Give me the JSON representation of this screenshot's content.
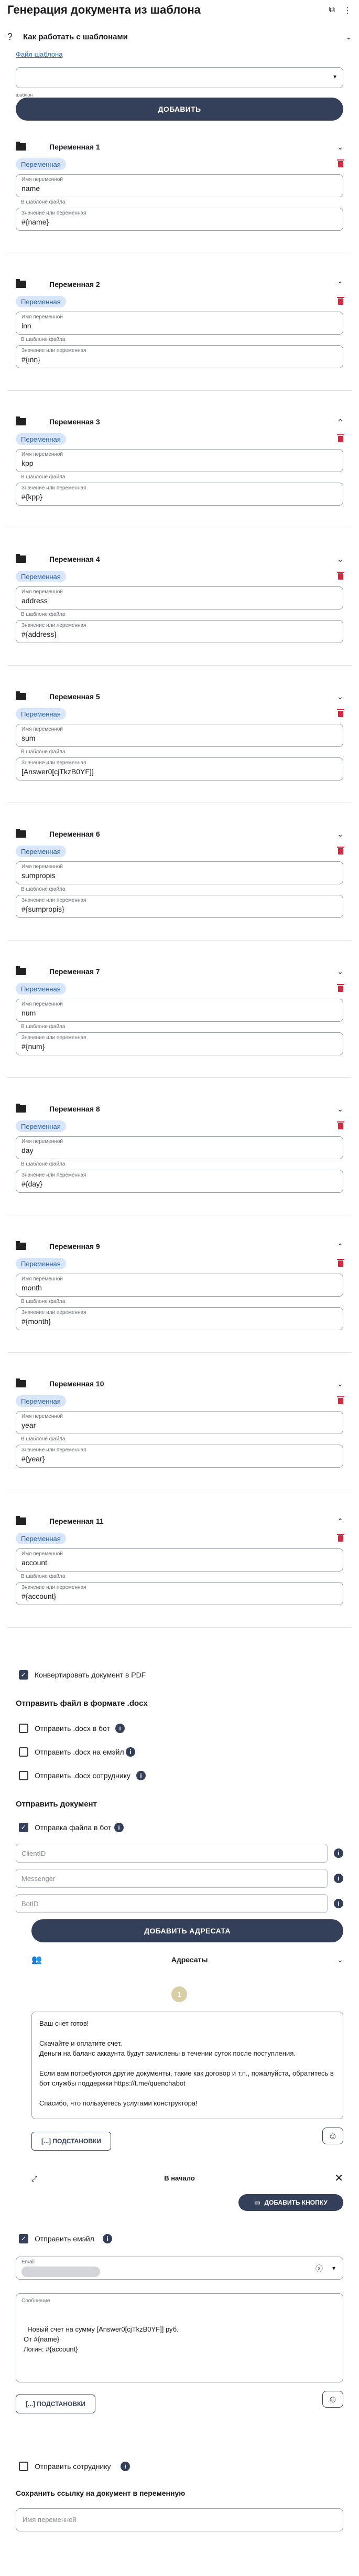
{
  "header": {
    "title": "Генерация документа из шаблона",
    "icons": [
      "copy-icon",
      "more-vertical-icon"
    ]
  },
  "howto": {
    "label": "Как работать с шаблонами",
    "link": "Файл шаблона"
  },
  "template": {
    "select_label": "шаблон",
    "add_button": "ДОБАВИТЬ"
  },
  "variable_labels": {
    "chip": "Переменная",
    "name_label": "Имя переменной",
    "helper": "В шаблоне файла",
    "value_label": "Значение или переменная"
  },
  "variables": [
    {
      "title": "Переменная 1",
      "name": "name",
      "value": "#{name}",
      "expanded": false
    },
    {
      "title": "Переменная 2",
      "name": "inn",
      "value": "#{inn}",
      "expanded": true
    },
    {
      "title": "Переменная 3",
      "name": "kpp",
      "value": "#{kpp}",
      "expanded": true
    },
    {
      "title": "Переменная 4",
      "name": "address",
      "value": "#{address}",
      "expanded": false
    },
    {
      "title": "Переменная 5",
      "name": "sum",
      "value": "[Answer0[cjTkzB0YF]]",
      "expanded": false
    },
    {
      "title": "Переменная 6",
      "name": "sumpropis",
      "value": "#{sumpropis}",
      "expanded": false
    },
    {
      "title": "Переменная 7",
      "name": "num",
      "value": "#{num}",
      "expanded": false
    },
    {
      "title": "Переменная 8",
      "name": "day",
      "value": "#{day}",
      "expanded": false
    },
    {
      "title": "Переменная 9",
      "name": "month",
      "value": "#{month}",
      "expanded": true
    },
    {
      "title": "Переменная 10",
      "name": "year",
      "value": "#{year}",
      "expanded": false
    },
    {
      "title": "Переменная 11",
      "name": "account",
      "value": "#{account}",
      "expanded": true
    }
  ],
  "convert_pdf": "Конвертировать документ в PDF",
  "docx_section": {
    "title": "Отправить файл в формате .docx",
    "options": [
      "Отправить .docx в бот",
      "Отправить .docx на емэйл",
      "Отправить .docx сотруднику"
    ]
  },
  "send_section": {
    "title": "Отправить документ",
    "send_bot": "Отправка файла в бот",
    "placeholders": [
      "ClientID",
      "Messenger",
      "BotID"
    ],
    "add_recipient": "ДОБАВИТЬ АДРЕСАТА",
    "recipients_label": "Адресаты",
    "step_number": "1"
  },
  "bot_message": {
    "text": "Ваш счет готов!\n\nСкачайте и оплатите счет.\nДеньги на баланс аккаунта будут зачислены в течении суток после поступления.\n\nЕсли вам потребуются другие документы, такие как договор и т.п., пожалуйста, обратитесь в бот службы поддержки https://t.me/quenchabot\n\nСпасибо, что пользуетесь услугами конструктора!",
    "substitutions_button": "[...] ПОДСТАНОВКИ",
    "at_start": "В начало",
    "add_button": "ДОБАВИТЬ КНОПКУ"
  },
  "email_section": {
    "label": "Отправить емэйл",
    "email_label": "Email",
    "message_label": "Сообщение",
    "message": "Новый счет на сумму [Answer0[cjTkzB0YF]] руб.\nОт #{name}\nЛогин: #{account}",
    "substitutions_button": "[...] ПОДСТАНОВКИ"
  },
  "employee": "Отправить сотруднику",
  "save_link": {
    "title": "Сохранить ссылку на документ в переменную",
    "placeholder": "Имя переменной"
  }
}
